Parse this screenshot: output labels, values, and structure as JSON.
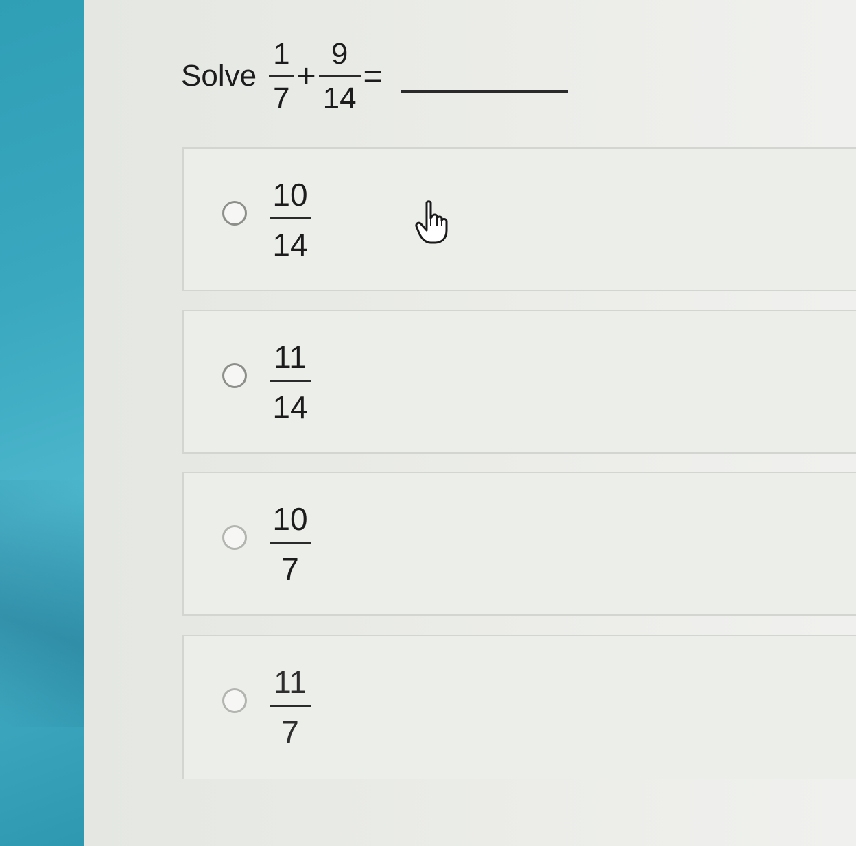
{
  "question": {
    "prefix": "Solve",
    "term1": {
      "numerator": "1",
      "denominator": "7"
    },
    "operator": "+",
    "term2": {
      "numerator": "9",
      "denominator": "14"
    },
    "equals": "="
  },
  "options": [
    {
      "numerator": "10",
      "denominator": "14"
    },
    {
      "numerator": "11",
      "denominator": "14"
    },
    {
      "numerator": "10",
      "denominator": "7"
    },
    {
      "numerator": "11",
      "denominator": "7"
    }
  ],
  "cursor_icon": "hand-pointer-icon"
}
